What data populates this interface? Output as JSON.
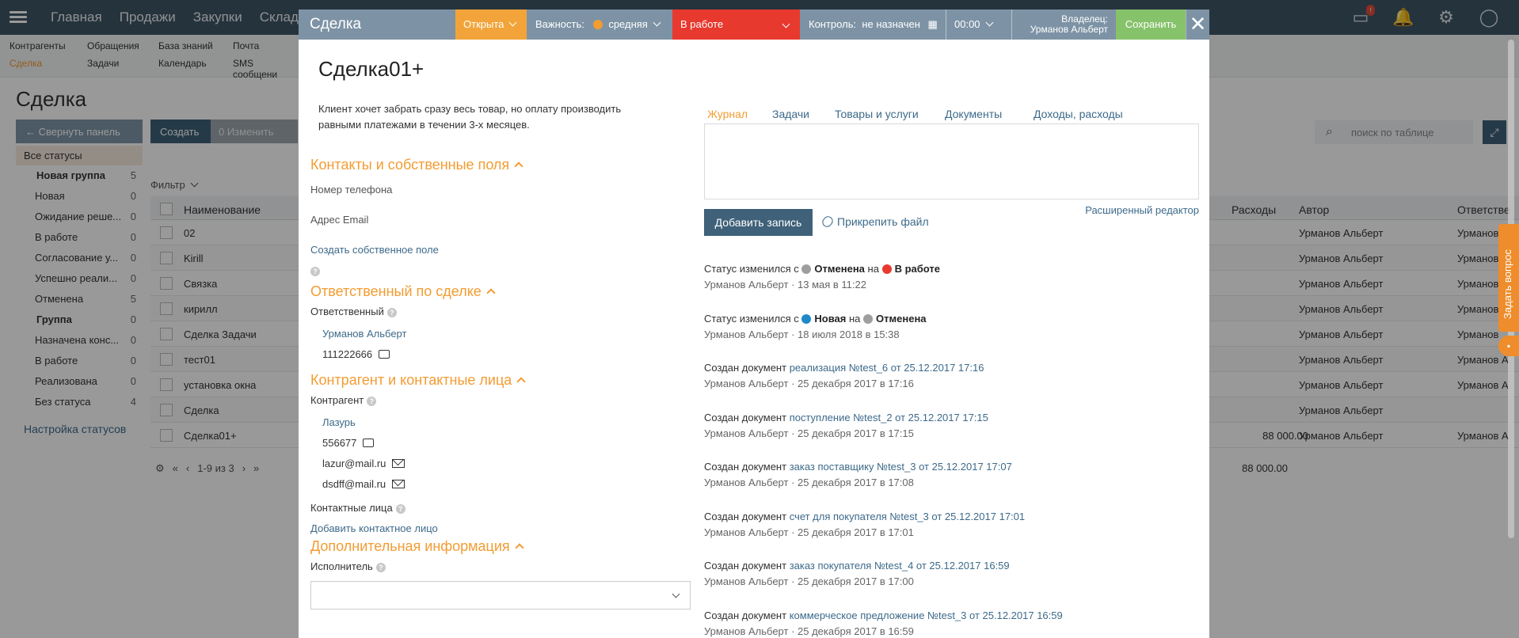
{
  "app": {
    "nav": [
      "Главная",
      "Продажи",
      "Закупки",
      "Склады"
    ],
    "badge": "!",
    "subnav": [
      "Контрагенты",
      "Обращения",
      "База знаний",
      "Почта",
      "Сделка",
      "Задачи",
      "Календарь",
      "SMS сообщени"
    ],
    "page_title": "Сделка",
    "collapse_panel": "← Свернуть панель",
    "create": "Создать",
    "edit": "0   Изменить",
    "search_placeholder": "поиск по таблице",
    "all_statuses": "Все статусы",
    "status_tree": [
      {
        "label": "Новая группа",
        "count": "5",
        "group": true
      },
      {
        "label": "Новая",
        "count": "0"
      },
      {
        "label": "Ожидание реше...",
        "count": "0"
      },
      {
        "label": "В работе",
        "count": "0"
      },
      {
        "label": "Согласование у...",
        "count": "0"
      },
      {
        "label": "Успешно реали...",
        "count": "0"
      },
      {
        "label": "Отменена",
        "count": "5"
      },
      {
        "label": "Группа",
        "count": "0",
        "group": true
      },
      {
        "label": "Назначена конс...",
        "count": "0"
      },
      {
        "label": "В работе",
        "count": "0"
      },
      {
        "label": "Реализована",
        "count": "0"
      },
      {
        "label": "Без статуса",
        "count": "4"
      }
    ],
    "status_settings": "Настройка статусов",
    "filter": "Фильтр",
    "table": {
      "headers": {
        "name": "Наименование",
        "expenses": "Расходы",
        "author": "Автор",
        "responsible": "Ответстве"
      },
      "rows": [
        {
          "name": "02",
          "expenses": "",
          "author": "Урманов Альберт",
          "responsible": "Урманов"
        },
        {
          "name": "Kirill",
          "expenses": "",
          "author": "Урманов Альберт",
          "responsible": "Урманов"
        },
        {
          "name": "Связка",
          "expenses": "",
          "author": "Урманов Альберт",
          "responsible": "Урманов"
        },
        {
          "name": "кирилл",
          "expenses": "",
          "author": "Урманов Альберт",
          "responsible": "Урманов"
        },
        {
          "name": "Сделка Задачи",
          "expenses": "",
          "author": "Урманов Альберт",
          "responsible": "Урманов"
        },
        {
          "name": "тест01",
          "expenses": "",
          "author": "Урманов Альберт",
          "responsible": "Урманов А"
        },
        {
          "name": "установка окна",
          "expenses": "",
          "author": "Урманов Альберт",
          "responsible": "Урманов А"
        },
        {
          "name": "Сделка",
          "expenses": "",
          "author": "Урманов Альберт",
          "responsible": ""
        },
        {
          "name": "Сделка01+",
          "expenses": "88 000.00",
          "author": "Урманов Альберт",
          "responsible": "Урманов А"
        }
      ],
      "pager": "1-9 из 3",
      "total_expenses": "88 000.00"
    },
    "ask_question": "Задать вопрос"
  },
  "modal": {
    "title": "Сделка",
    "state": "Открыта",
    "importance_label": "Важность:",
    "importance_value": "средняя",
    "importance_color": "#f39c32",
    "status": "В работе",
    "control_label": "Контроль:",
    "control_value": "не назначен",
    "time": "00:00",
    "owner_label": "Владелец:",
    "owner_name": "Урманов Альберт",
    "save": "Сохранить",
    "deal_name": "Сделка01+",
    "description": "Клиент хочет забрать сразу весь товар, но оплату производить равными платежами в течении 3-х месяцев.",
    "sections": {
      "contacts": {
        "title": "Контакты и собственные поля",
        "phone_label": "Номер телефона",
        "email_label": "Адрес Email",
        "create_field": "Создать собственное поле"
      },
      "responsible": {
        "title": "Ответственный по сделке",
        "label": "Ответственный",
        "name": "Урманов Альберт",
        "phone": "111222666"
      },
      "counterparty": {
        "title": "Контрагент и контактные лица",
        "label": "Контрагент",
        "name": "Лазурь",
        "phone": "556677",
        "emails": [
          "lazur@mail.ru",
          "dsdff@mail.ru"
        ],
        "contacts_label": "Контактные лица",
        "add_contact": "Добавить контактное лицо"
      },
      "extra": {
        "title": "Дополнительная информация",
        "executor_label": "Исполнитель"
      }
    },
    "tabs": [
      "Журнал",
      "Задачи",
      "Товары и услуги",
      "Документы",
      "Доходы, расходы"
    ],
    "advanced_editor": "Расширенный редактор",
    "add_record": "Добавить запись",
    "attach_file": "Прикрепить файл",
    "journal": [
      {
        "type": "status",
        "prefix": "Статус изменился с",
        "from": "Отменена",
        "from_color": "#9e9e9e",
        "mid": "на",
        "to": "В работе",
        "to_color": "#e8392f",
        "meta": "Урманов Альберт · 13 мая в 11:22"
      },
      {
        "type": "status",
        "prefix": "Статус изменился с",
        "from": "Новая",
        "from_color": "#1e88c8",
        "mid": "на",
        "to": "Отменена",
        "to_color": "#9e9e9e",
        "meta": "Урманов Альберт · 18 июля 2018 в 15:38"
      },
      {
        "type": "doc",
        "prefix": "Создан документ",
        "doc": "реализация №test_6 от 25.12.2017 17:16",
        "meta": "Урманов Альберт · 25 декабря 2017 в 17:16"
      },
      {
        "type": "doc",
        "prefix": "Создан документ",
        "doc": "поступление №test_2 от 25.12.2017 17:15",
        "meta": "Урманов Альберт · 25 декабря 2017 в 17:15"
      },
      {
        "type": "doc",
        "prefix": "Создан документ",
        "doc": "заказ поставщику №test_3 от 25.12.2017 17:07",
        "meta": "Урманов Альберт · 25 декабря 2017 в 17:08"
      },
      {
        "type": "doc",
        "prefix": "Создан документ",
        "doc": "счет для покупателя №test_3 от 25.12.2017 17:01",
        "meta": "Урманов Альберт · 25 декабря 2017 в 17:01"
      },
      {
        "type": "doc",
        "prefix": "Создан документ",
        "doc": "заказ покупателя №test_4 от 25.12.2017 16:59",
        "meta": "Урманов Альберт · 25 декабря 2017 в 17:00"
      },
      {
        "type": "doc",
        "prefix": "Создан документ",
        "doc": "коммерческое предложение №test_3 от 25.12.2017 16:59",
        "meta": "Урманов Альберт · 25 декабря 2017 в 16:59"
      }
    ]
  }
}
